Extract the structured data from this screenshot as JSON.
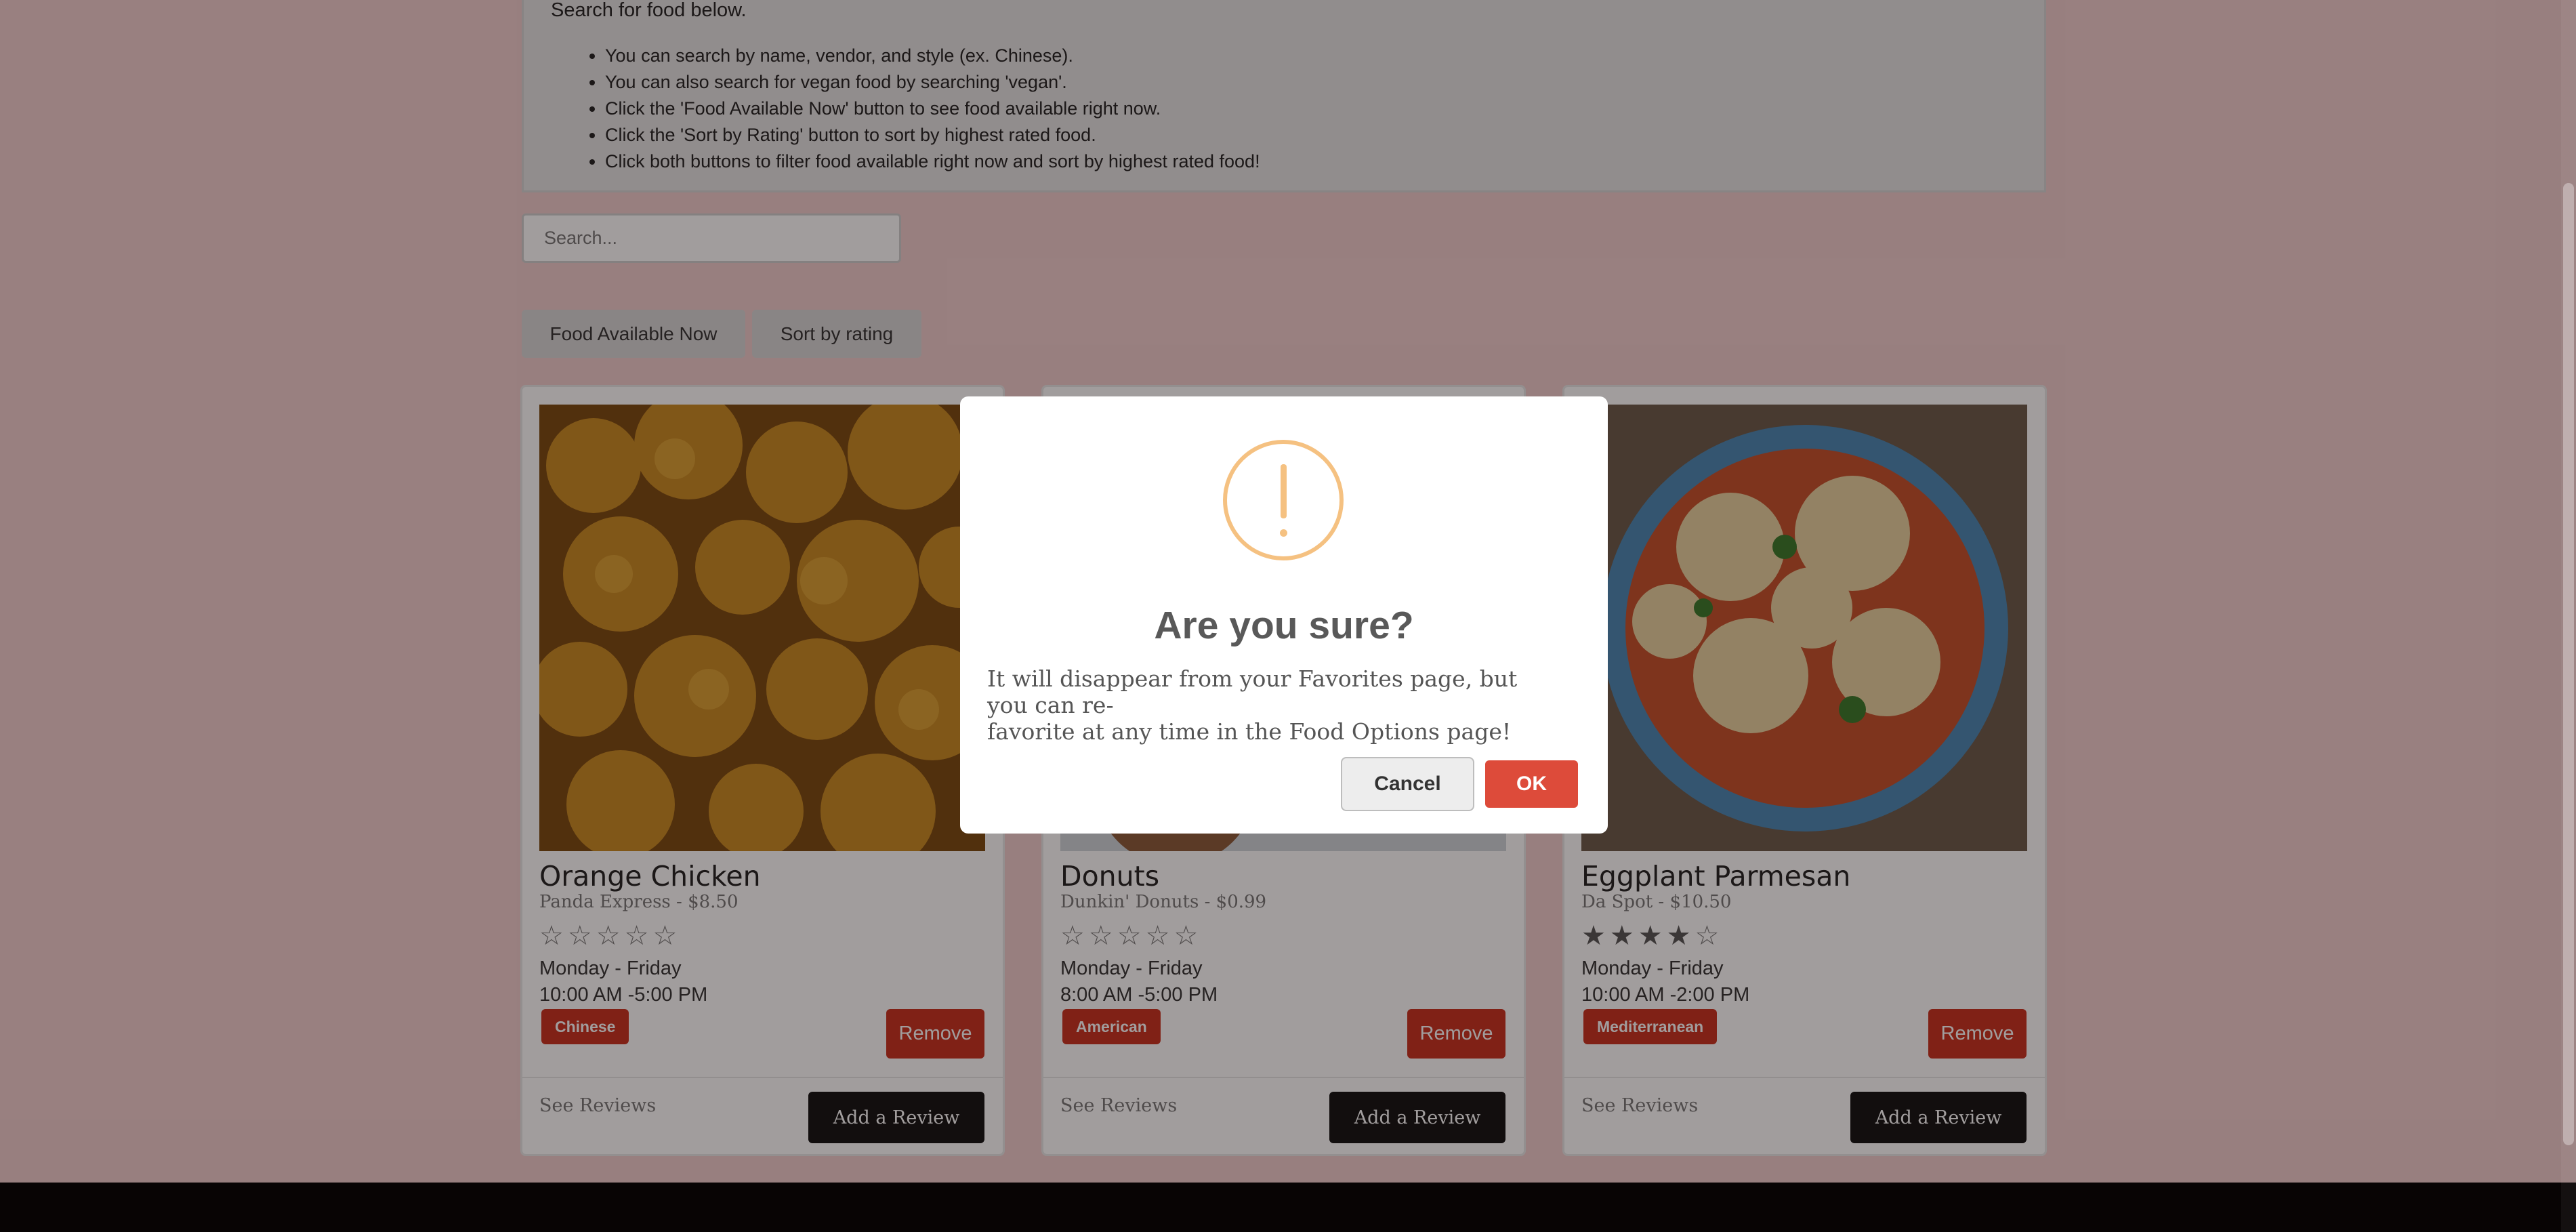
{
  "info": {
    "intro": "Search for food below.",
    "tips": [
      "You can search by name, vendor, and style (ex. Chinese).",
      "You can also search for vegan food by searching 'vegan'.",
      "Click the 'Food Available Now' button to see food available right now.",
      "Click the 'Sort by Rating' button to sort by highest rated food.",
      "Click both buttons to filter food available right now and sort by highest rated food!"
    ]
  },
  "search": {
    "placeholder": "Search...",
    "value": ""
  },
  "filters": {
    "available_label": "Food Available Now",
    "sort_label": "Sort by rating"
  },
  "cards": [
    {
      "title": "Orange Chicken",
      "subtitle": "Panda Express - $8.50",
      "rating": 0,
      "days": "Monday - Friday",
      "hours": "10:00 AM -5:00 PM",
      "tag": "Chinese",
      "remove_label": "Remove",
      "see_reviews": "See Reviews",
      "add_review": "Add a Review"
    },
    {
      "title": "Donuts",
      "subtitle": "Dunkin' Donuts - $0.99",
      "rating": 0,
      "days": "Monday - Friday",
      "hours": "8:00 AM -5:00 PM",
      "tag": "American",
      "remove_label": "Remove",
      "see_reviews": "See Reviews",
      "add_review": "Add a Review"
    },
    {
      "title": "Eggplant Parmesan",
      "subtitle": "Da Spot - $10.50",
      "rating": 4,
      "days": "Monday - Friday",
      "hours": "10:00 AM -2:00 PM",
      "tag": "Mediterranean",
      "remove_label": "Remove",
      "see_reviews": "See Reviews",
      "add_review": "Add a Review"
    }
  ],
  "dialog": {
    "icon": "warning-icon",
    "title": "Are you sure?",
    "text_line1": "It will disappear from your Favorites page, but you can re-",
    "text_line2": "favorite at any time in the Food Options page!",
    "cancel_label": "Cancel",
    "ok_label": "OK"
  },
  "colors": {
    "background": "#f1cece",
    "accent_red": "#c9311f",
    "ok_button": "#dd4b3a",
    "warning": "#f5c181"
  }
}
